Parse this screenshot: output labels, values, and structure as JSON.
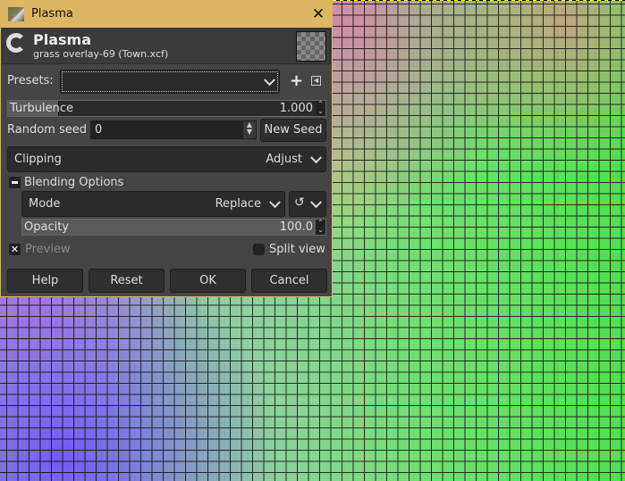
{
  "window": {
    "title": "Plasma"
  },
  "header": {
    "title": "Plasma",
    "subtitle": "grass overlay-69 (Town.xcf)"
  },
  "presets": {
    "label": "Presets:",
    "value": ""
  },
  "turbulence": {
    "label": "Turbulence",
    "value": "1.000",
    "fill_fraction": 0.16
  },
  "random_seed": {
    "label": "Random seed",
    "value": "0",
    "new_seed": "New Seed"
  },
  "clipping": {
    "label": "Clipping",
    "value": "Adjust"
  },
  "blending": {
    "label": "Blending Options",
    "mode_label": "Mode",
    "mode_value": "Replace",
    "opacity_label": "Opacity",
    "opacity_value": "100.0"
  },
  "preview": {
    "label": "Preview",
    "checked": true
  },
  "split_view": {
    "label": "Split view",
    "checked": false
  },
  "buttons": {
    "help": "Help",
    "reset": "Reset",
    "ok": "OK",
    "cancel": "Cancel"
  }
}
